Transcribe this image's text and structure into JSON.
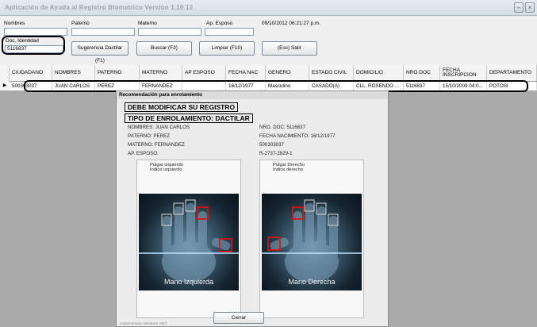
{
  "window": {
    "title": "Aplicación de Ayuda al Registro Biometrico Version 1.10.12",
    "btn_minimize": "–",
    "btn_close": "×"
  },
  "search": {
    "nombres_label": "Nombres",
    "paterno_label": "Paterno",
    "materno_label": "Materno",
    "esposo_label": "Ap. Esposo",
    "datetime": "09/10/2012 06:21:27 p.m.",
    "doc_label": "Doc. Identidad",
    "doc_value": "5116837",
    "btn_sugerencia": "Sugerencia Dactilar (F1)",
    "btn_buscar": "Buscar (F3)",
    "btn_limpiar": "Limpiar (F10)",
    "btn_salir": "(Esc) Salir"
  },
  "grid": {
    "columns": [
      "CIUDADANO",
      "NOMBRES",
      "PATERNO",
      "MATERNO",
      "AP ESPOSO",
      "FECHA NAC",
      "GENERO",
      "ESTADO CIVIL",
      "DOMICILIO",
      "NRO DOC",
      "FECHA INSCRIPCION",
      "DEPARTAMENTO"
    ],
    "row": [
      "500303037",
      "JUAN CARLOS",
      "PEREZ",
      "FERNANDEZ",
      "",
      "16/12/1977",
      "Masculino",
      "CASADO(A)",
      "CLL. ROSENDO ...",
      "5116837",
      "15/10/2009 04:0...",
      "POTOSI"
    ],
    "row_pointer": "▶"
  },
  "dialog": {
    "title": "Recomendación para enrolamiento",
    "warning1": "DEBE MODIFICAR SU REGISTRO",
    "warning2": "TIPO DE ENROLAMIENTO: DACTILAR",
    "nombres": "NOMBRES: JUAN CARLOS",
    "paterno": "PATERNO: PEREZ",
    "materno": "MATERNO: FERNANDEZ",
    "esposo": "AP. ESPOSO:",
    "nro_doc": "NRO. DOC: 5116837",
    "fecha_nac": "FECHA NACIMIENTO: 16/12/1977",
    "codigo": "500303037",
    "referencia": "R-2737-2829-1",
    "left_hand": {
      "label1": "Pulgar izquierdo",
      "label2": "Indice izquierdo",
      "name": "Mano Izquierda"
    },
    "right_hand": {
      "label1": "Pulgar Derecho",
      "label2": "Indice derecho",
      "name": "Mano Derecha"
    },
    "btn_cerrar": "Cerrar",
    "footer": "Implementado Windows .NET"
  },
  "colors": {
    "highlight": "#e01010",
    "grid_bg": "#aaaaaa"
  }
}
